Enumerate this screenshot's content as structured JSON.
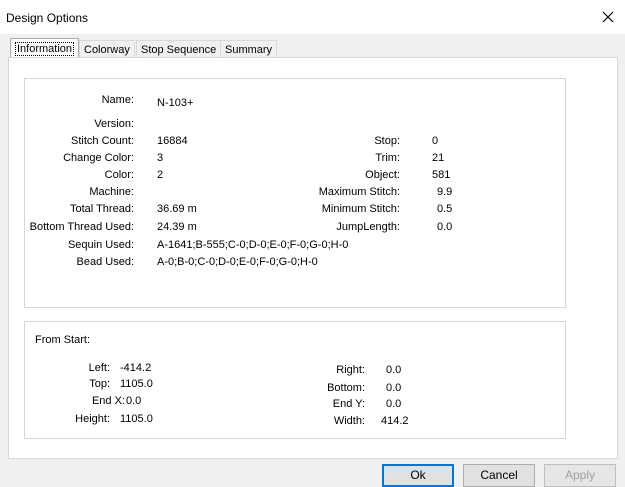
{
  "window": {
    "title": "Design Options"
  },
  "tabs": [
    "Information",
    "Colorway",
    "Stop Sequence",
    "Summary"
  ],
  "info": {
    "name_label": "Name:",
    "name_value": "N-103+",
    "version_label": "Version:",
    "version_value": "",
    "stitch_count_label": "Stitch Count:",
    "stitch_count_value": "16884",
    "change_color_label": "Change Color:",
    "change_color_value": "3",
    "color_label": "Color:",
    "color_value": "2",
    "machine_label": "Machine:",
    "machine_value": "",
    "total_thread_label": "Total Thread:",
    "total_thread_value": "36.69 m",
    "bottom_thread_label": "Bottom Thread Used:",
    "bottom_thread_value": "24.39 m",
    "sequin_label": "Sequin Used:",
    "sequin_value": "A-1641;B-555;C-0;D-0;E-0;F-0;G-0;H-0",
    "bead_label": "Bead Used:",
    "bead_value": "A-0;B-0;C-0;D-0;E-0;F-0;G-0;H-0",
    "stop_label": "Stop:",
    "stop_value": "0",
    "trim_label": "Trim:",
    "trim_value": "21",
    "object_label": "Object:",
    "object_value": "581",
    "max_stitch_label": "Maximum Stitch:",
    "max_stitch_value": "9.9",
    "min_stitch_label": "Minimum Stitch:",
    "min_stitch_value": "0.5",
    "jump_length_label": "JumpLength:",
    "jump_length_value": "0.0"
  },
  "from_start": {
    "heading": "From Start:",
    "left_label": "Left:",
    "left_value": "-414.2",
    "top_label": "Top:",
    "top_value": "1105.0",
    "endx_label": "End X:",
    "endx_value": "0.0",
    "height_label": "Height:",
    "height_value": "1105.0",
    "right_label": "Right:",
    "right_value": "0.0",
    "bottom_label": "Bottom:",
    "bottom_value": "0.0",
    "endy_label": "End Y:",
    "endy_value": "0.0",
    "width_label": "Width:",
    "width_value": "414.2"
  },
  "buttons": {
    "ok": "Ok",
    "cancel": "Cancel",
    "apply": "Apply"
  }
}
